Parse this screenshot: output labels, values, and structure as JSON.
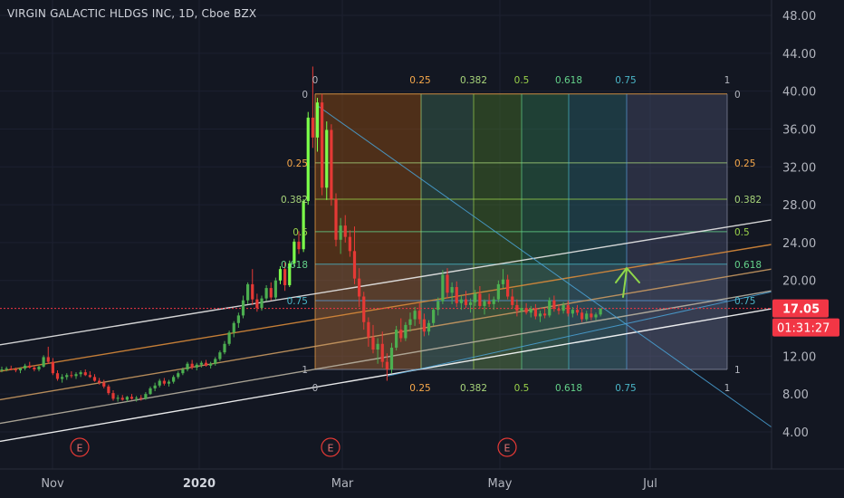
{
  "header": {
    "symbol": "VIRGIN GALACTIC HLDGS INC",
    "interval": "1D",
    "exchange": "Cboe BZX",
    "sep": ", "
  },
  "price_badge": {
    "value": "17.05",
    "countdown": "01:31:27"
  },
  "earnings_marker": "E",
  "colors": {
    "background": "#131722",
    "up": "#4caf50",
    "up_bright": "#7cff4a",
    "down": "#e53935",
    "axis_text": "#b2b5be",
    "grid": "#1e222d",
    "badge": "#f23645"
  },
  "chart_data": {
    "type": "candlestick",
    "y_axis": {
      "ticks": [
        "48.00",
        "44.00",
        "40.00",
        "36.00",
        "32.00",
        "28.00",
        "24.00",
        "20.00",
        "12.00",
        "8.00",
        "4.00"
      ],
      "range": [
        0,
        50
      ]
    },
    "x_axis": {
      "ticks": [
        "Nov",
        "2020",
        "Mar",
        "May",
        "Jul"
      ]
    },
    "current_price": 17.05,
    "fib_levels": {
      "top_labels": [
        "0",
        "0.25",
        "0.382",
        "0.5",
        "0.618",
        "0.75",
        "1"
      ],
      "right_labels": [
        "0",
        "0.25",
        "0.382",
        "0.5",
        "0.618",
        "0.75",
        "1"
      ],
      "left_labels": [
        "0",
        "0.25",
        "0.382",
        "0.5",
        "0.618",
        "0.75",
        "1"
      ],
      "bottom_labels": [
        "0",
        "0.25",
        "0.382",
        "0.5",
        "0.618",
        "0.75",
        "1"
      ],
      "price_high": 39.7,
      "price_low": 10.6
    },
    "ohlc": [
      [
        10.5,
        10.9,
        10.3,
        10.6
      ],
      [
        10.6,
        10.9,
        10.4,
        10.7
      ],
      [
        10.7,
        11.0,
        10.5,
        10.6
      ],
      [
        10.6,
        10.8,
        10.3,
        10.5
      ],
      [
        10.5,
        10.8,
        10.2,
        10.7
      ],
      [
        10.7,
        11.2,
        10.5,
        11.0
      ],
      [
        11.0,
        11.4,
        10.7,
        10.8
      ],
      [
        10.8,
        11.0,
        10.4,
        10.6
      ],
      [
        10.6,
        11.0,
        10.4,
        10.9
      ],
      [
        10.9,
        12.1,
        10.8,
        11.9
      ],
      [
        11.9,
        13.0,
        11.2,
        11.4
      ],
      [
        11.4,
        11.8,
        10.0,
        10.2
      ],
      [
        10.2,
        10.5,
        9.4,
        9.6
      ],
      [
        9.6,
        10.1,
        9.2,
        9.8
      ],
      [
        9.8,
        10.2,
        9.5,
        10.0
      ],
      [
        10.0,
        10.4,
        9.7,
        9.9
      ],
      [
        9.9,
        10.3,
        9.6,
        10.1
      ],
      [
        10.1,
        10.5,
        9.8,
        10.3
      ],
      [
        10.3,
        10.6,
        9.9,
        10.0
      ],
      [
        10.0,
        10.4,
        9.7,
        9.8
      ],
      [
        9.8,
        10.1,
        9.3,
        9.4
      ],
      [
        9.4,
        9.7,
        9.0,
        9.2
      ],
      [
        9.2,
        9.5,
        8.6,
        8.8
      ],
      [
        8.8,
        9.0,
        7.9,
        8.1
      ],
      [
        8.1,
        8.4,
        7.3,
        7.5
      ],
      [
        7.5,
        7.9,
        7.2,
        7.6
      ],
      [
        7.6,
        7.9,
        7.3,
        7.4
      ],
      [
        7.4,
        7.8,
        7.2,
        7.7
      ],
      [
        7.7,
        8.0,
        7.4,
        7.5
      ],
      [
        7.5,
        7.8,
        7.2,
        7.6
      ],
      [
        7.6,
        7.9,
        7.3,
        7.5
      ],
      [
        7.5,
        8.2,
        7.4,
        8.0
      ],
      [
        8.0,
        8.8,
        7.9,
        8.6
      ],
      [
        8.6,
        9.2,
        8.3,
        8.9
      ],
      [
        8.9,
        9.6,
        8.7,
        9.4
      ],
      [
        9.4,
        9.7,
        8.9,
        9.1
      ],
      [
        9.1,
        9.5,
        8.8,
        9.3
      ],
      [
        9.3,
        10.0,
        9.1,
        9.8
      ],
      [
        9.8,
        10.4,
        9.6,
        10.2
      ],
      [
        10.2,
        10.8,
        10.0,
        10.6
      ],
      [
        10.6,
        11.4,
        10.4,
        11.2
      ],
      [
        11.2,
        11.6,
        10.6,
        10.8
      ],
      [
        10.8,
        11.3,
        10.5,
        11.1
      ],
      [
        11.1,
        11.5,
        10.8,
        11.3
      ],
      [
        11.3,
        11.6,
        10.9,
        11.0
      ],
      [
        11.0,
        11.4,
        10.7,
        11.2
      ],
      [
        11.2,
        11.9,
        11.0,
        11.7
      ],
      [
        11.7,
        12.6,
        11.5,
        12.4
      ],
      [
        12.4,
        13.6,
        12.2,
        13.3
      ],
      [
        13.3,
        14.7,
        13.1,
        14.5
      ],
      [
        14.5,
        15.7,
        14.0,
        15.5
      ],
      [
        15.5,
        16.6,
        15.0,
        16.3
      ],
      [
        16.3,
        18.4,
        16.0,
        17.9
      ],
      [
        17.9,
        19.8,
        17.5,
        19.6
      ],
      [
        19.6,
        21.2,
        17.4,
        18.0
      ],
      [
        18.0,
        18.6,
        16.7,
        17.1
      ],
      [
        17.1,
        18.4,
        16.8,
        18.1
      ],
      [
        18.1,
        19.5,
        17.8,
        19.2
      ],
      [
        19.2,
        19.8,
        17.9,
        18.2
      ],
      [
        18.2,
        20.3,
        18.0,
        20.0
      ],
      [
        20.0,
        21.5,
        19.6,
        21.2
      ],
      [
        21.2,
        21.9,
        18.9,
        19.5
      ],
      [
        19.5,
        22.1,
        19.3,
        21.8
      ],
      [
        21.8,
        24.4,
        21.5,
        24.1
      ],
      [
        24.1,
        25.2,
        22.8,
        23.3
      ],
      [
        23.3,
        28.6,
        23.0,
        28.4
      ],
      [
        28.4,
        37.8,
        28.0,
        37.2
      ],
      [
        37.2,
        42.6,
        34.0,
        35.1
      ],
      [
        35.1,
        39.3,
        33.6,
        38.8
      ],
      [
        38.8,
        39.7,
        29.0,
        29.8
      ],
      [
        29.8,
        36.8,
        28.5,
        35.9
      ],
      [
        35.9,
        36.5,
        27.9,
        28.6
      ],
      [
        28.6,
        29.2,
        23.6,
        24.3
      ],
      [
        24.3,
        26.6,
        22.8,
        25.8
      ],
      [
        25.8,
        26.9,
        24.0,
        24.6
      ],
      [
        24.6,
        25.3,
        22.5,
        23.1
      ],
      [
        23.1,
        25.7,
        19.6,
        20.2
      ],
      [
        20.2,
        21.3,
        17.2,
        18.3
      ],
      [
        18.3,
        18.8,
        14.8,
        15.6
      ],
      [
        15.6,
        16.1,
        13.0,
        14.0
      ],
      [
        14.0,
        15.3,
        12.3,
        12.7
      ],
      [
        12.7,
        13.9,
        11.2,
        13.3
      ],
      [
        13.3,
        14.6,
        10.8,
        11.4
      ],
      [
        11.4,
        12.3,
        9.4,
        10.6
      ],
      [
        10.6,
        13.4,
        10.2,
        12.9
      ],
      [
        12.9,
        15.2,
        12.6,
        14.8
      ],
      [
        14.8,
        16.0,
        13.5,
        13.9
      ],
      [
        13.9,
        15.6,
        13.6,
        15.3
      ],
      [
        15.3,
        16.6,
        14.6,
        15.9
      ],
      [
        15.9,
        17.2,
        15.2,
        16.8
      ],
      [
        16.8,
        17.6,
        15.4,
        15.9
      ],
      [
        15.9,
        16.5,
        14.1,
        14.6
      ],
      [
        14.6,
        15.8,
        14.2,
        15.5
      ],
      [
        15.5,
        17.1,
        15.2,
        16.9
      ],
      [
        16.9,
        18.2,
        16.3,
        17.8
      ],
      [
        17.8,
        21.1,
        17.5,
        20.6
      ],
      [
        20.6,
        21.3,
        18.1,
        18.7
      ],
      [
        18.7,
        19.8,
        17.5,
        19.3
      ],
      [
        19.3,
        19.9,
        17.2,
        17.6
      ],
      [
        17.6,
        18.4,
        16.9,
        18.0
      ],
      [
        18.0,
        18.9,
        17.1,
        17.4
      ],
      [
        17.4,
        18.1,
        16.6,
        17.7
      ],
      [
        17.7,
        19.0,
        17.3,
        18.6
      ],
      [
        18.6,
        19.4,
        17.0,
        17.3
      ],
      [
        17.3,
        18.0,
        16.4,
        17.8
      ],
      [
        17.8,
        18.6,
        17.2,
        17.5
      ],
      [
        17.5,
        18.3,
        16.9,
        18.0
      ],
      [
        18.0,
        20.0,
        17.7,
        19.6
      ],
      [
        19.6,
        21.2,
        19.2,
        20.1
      ],
      [
        20.1,
        20.6,
        18.0,
        18.3
      ],
      [
        18.3,
        19.1,
        17.0,
        17.4
      ],
      [
        17.4,
        18.0,
        16.2,
        16.8
      ],
      [
        16.8,
        17.4,
        16.0,
        17.1
      ],
      [
        17.1,
        17.6,
        16.4,
        16.6
      ],
      [
        16.6,
        17.3,
        16.1,
        17.0
      ],
      [
        17.0,
        17.5,
        15.9,
        16.2
      ],
      [
        16.2,
        16.8,
        15.6,
        16.5
      ],
      [
        16.5,
        17.1,
        16.0,
        16.3
      ],
      [
        16.3,
        18.2,
        16.1,
        17.9
      ],
      [
        17.9,
        18.4,
        16.7,
        17.0
      ],
      [
        17.0,
        17.5,
        16.4,
        16.8
      ],
      [
        16.8,
        17.7,
        16.5,
        17.4
      ],
      [
        17.4,
        17.9,
        16.2,
        16.5
      ],
      [
        16.5,
        17.2,
        16.1,
        16.9
      ],
      [
        16.9,
        17.4,
        16.3,
        16.6
      ],
      [
        16.6,
        17.0,
        15.6,
        15.9
      ],
      [
        15.9,
        16.8,
        15.7,
        16.5
      ],
      [
        16.5,
        17.0,
        15.8,
        16.1
      ],
      [
        16.1,
        16.6,
        15.8,
        16.4
      ],
      [
        16.4,
        17.05,
        16.2,
        17.05
      ]
    ]
  }
}
